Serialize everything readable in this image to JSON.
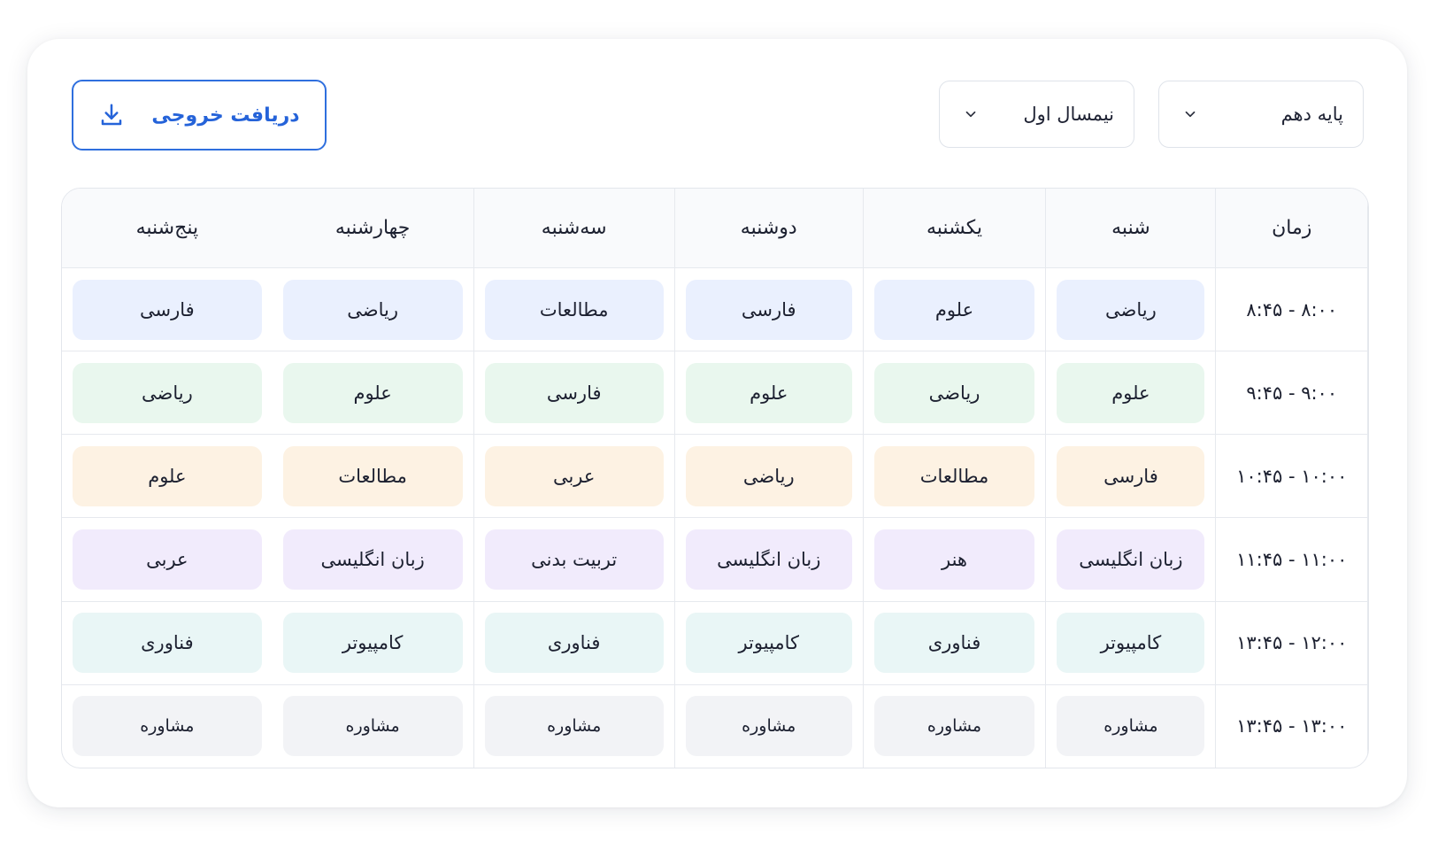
{
  "toolbar": {
    "export_label": "دریافت خروجی",
    "export_icon": "download-icon",
    "semester_value": "نیمسال اول",
    "grade_value": "پایه دهم",
    "chevron_icon": "chevron-down-icon",
    "accent_color": "#2563d9"
  },
  "schedule": {
    "headers": {
      "time": "زمان",
      "days": [
        "شنبه",
        "یکشنبه",
        "دوشنبه",
        "سه‌شنبه",
        "چهارشنبه",
        "پنج‌شنبه"
      ]
    },
    "rows": [
      {
        "time": "۸:۰۰ - ۸:۴۵",
        "color": "#eaf0fe",
        "cells": [
          "ریاضی",
          "علوم",
          "فارسی",
          "مطالعات",
          "ریاضی",
          "فارسی"
        ]
      },
      {
        "time": "۹:۰۰ - ۹:۴۵",
        "color": "#e9f7ee",
        "cells": [
          "علوم",
          "ریاضی",
          "علوم",
          "فارسی",
          "علوم",
          "ریاضی"
        ]
      },
      {
        "time": "۱۰:۰۰ - ۱۰:۴۵",
        "color": "#fdf2e3",
        "cells": [
          "فارسی",
          "مطالعات",
          "ریاضی",
          "عربی",
          "مطالعات",
          "علوم"
        ]
      },
      {
        "time": "۱۱:۰۰ - ۱۱:۴۵",
        "color": "#f1ebfc",
        "cells": [
          "زبان انگلیسی",
          "هنر",
          "زبان انگلیسی",
          "تربیت بدنی",
          "زبان انگلیسی",
          "عربی"
        ]
      },
      {
        "time": "۱۲:۰۰ - ۱۳:۴۵",
        "color": "#e9f6f6",
        "cells": [
          "کامپیوتر",
          "فناوری",
          "کامپیوتر",
          "فناوری",
          "کامپیوتر",
          "فناوری"
        ]
      },
      {
        "time": "۱۳:۰۰ - ۱۳:۴۵",
        "color": "#f2f3f6",
        "cells": [
          "مشاوره",
          "مشاوره",
          "مشاوره",
          "مشاوره",
          "مشاوره",
          "مشاوره"
        ]
      }
    ]
  }
}
